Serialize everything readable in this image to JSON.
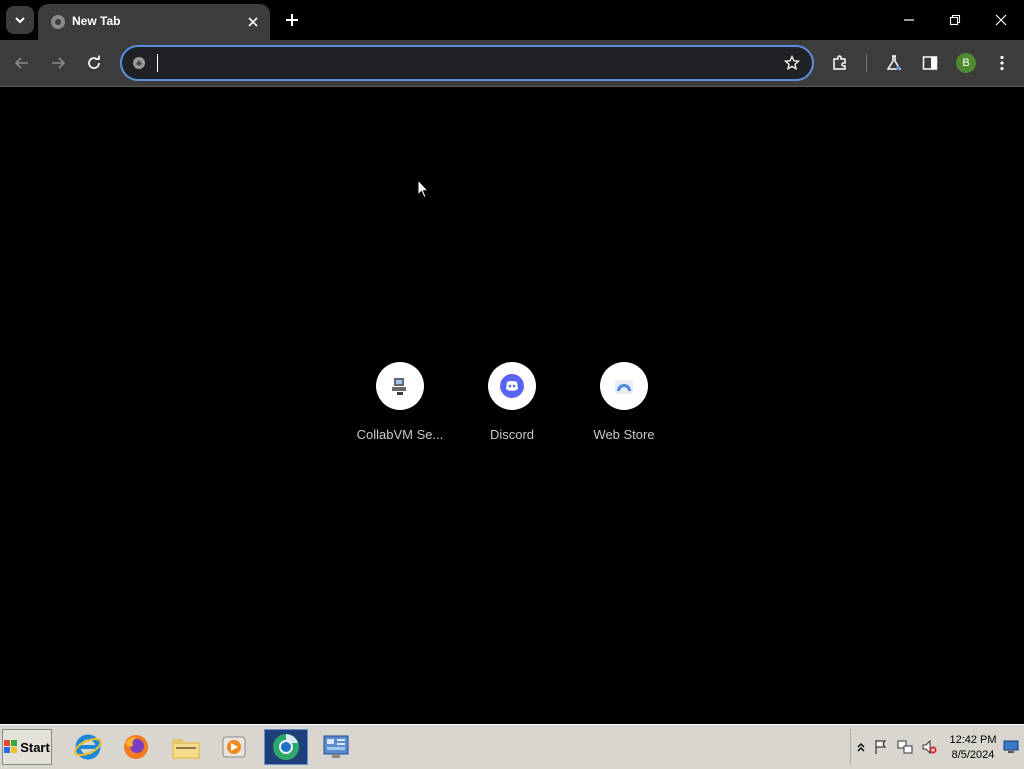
{
  "tab": {
    "title": "New Tab"
  },
  "omnibox": {
    "value": "",
    "placeholder": ""
  },
  "profile": {
    "initial": "B",
    "color": "#4e8a2e"
  },
  "shortcuts": [
    {
      "label": "CollabVM Se...",
      "icon": "collabvm-icon"
    },
    {
      "label": "Discord",
      "icon": "discord-icon"
    },
    {
      "label": "Web Store",
      "icon": "web-store-icon"
    }
  ],
  "taskbar": {
    "start_label": "Start",
    "apps": [
      "internet-explorer-icon",
      "firefox-icon",
      "file-explorer-icon",
      "media-player-icon",
      "chrome-icon",
      "control-panel-icon"
    ],
    "clock_time": "12:42 PM",
    "clock_date": "8/5/2024"
  },
  "colors": {
    "page_bg": "#000000",
    "toolbar_bg": "#3c3c3c",
    "omnibox_focus": "#5b8fdc",
    "discord": "#5865f2",
    "taskbar_bg": "#d9d6cf"
  }
}
